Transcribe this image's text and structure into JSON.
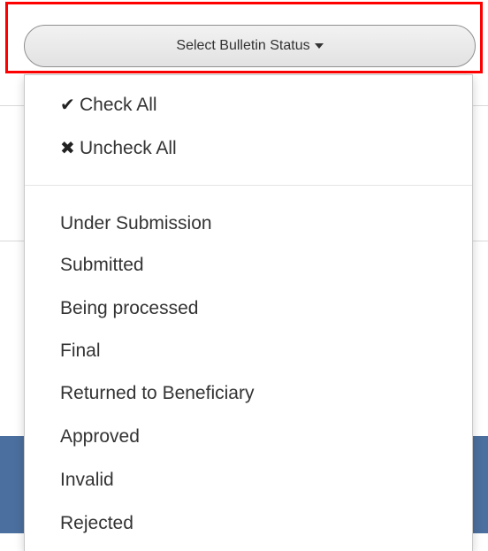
{
  "select_button": {
    "label": "Select Bulletin Status"
  },
  "actions": [
    {
      "icon": "checkmark-icon",
      "glyph": "✔",
      "label": "Check All"
    },
    {
      "icon": "x-mark-icon",
      "glyph": "✖",
      "label": "Uncheck All"
    }
  ],
  "statuses": [
    "Under Submission",
    "Submitted",
    "Being processed",
    "Final",
    "Returned to Beneficiary",
    "Approved",
    "Invalid",
    "Rejected"
  ],
  "colors": {
    "highlight": "#ff0000",
    "background_band": "#4b6f9e"
  }
}
